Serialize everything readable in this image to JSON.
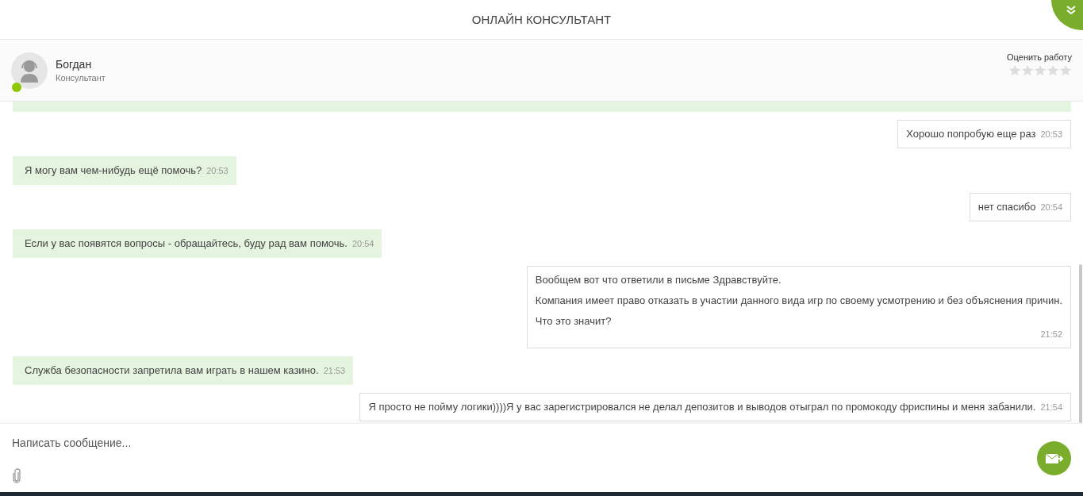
{
  "header": {
    "title": "ОНЛАЙН КОНСУЛЬТАНТ"
  },
  "agent": {
    "name": "Богдан",
    "role": "Консультант",
    "online": true,
    "rating_label": "Оценить работу",
    "stars": 0
  },
  "messages": [
    {
      "kind": "user",
      "paragraphs": [
        "Хорошо попробую еще раз"
      ],
      "time": "20:53"
    },
    {
      "kind": "agent",
      "paragraphs": [
        "Я могу вам чем-нибудь ещё помочь?"
      ],
      "time": "20:53"
    },
    {
      "kind": "user",
      "paragraphs": [
        "нет спасибо"
      ],
      "time": "20:54"
    },
    {
      "kind": "agent",
      "paragraphs": [
        "Если у вас появятся вопросы - обращайтесь, буду рад вам помочь."
      ],
      "time": "20:54"
    },
    {
      "kind": "user",
      "paragraphs": [
        "Вообщем вот что ответили в письме Здравствуйте.",
        "Компания имеет право отказать в участии данного вида игр по своему усмотрению и без объяснения причин.",
        "Что это значит?"
      ],
      "time": "21:52"
    },
    {
      "kind": "agent",
      "paragraphs": [
        "Служба безопасности запретила вам играть в нашем казино."
      ],
      "time": "21:53"
    },
    {
      "kind": "user",
      "paragraphs": [
        "Я просто не пойму логики))))Я у вас зарегистрировался не делал депозитов и выводов отыграл по промокоду фриспины и меня забанили."
      ],
      "time": "21:54"
    }
  ],
  "composer": {
    "placeholder": "Написать сообщение..."
  }
}
